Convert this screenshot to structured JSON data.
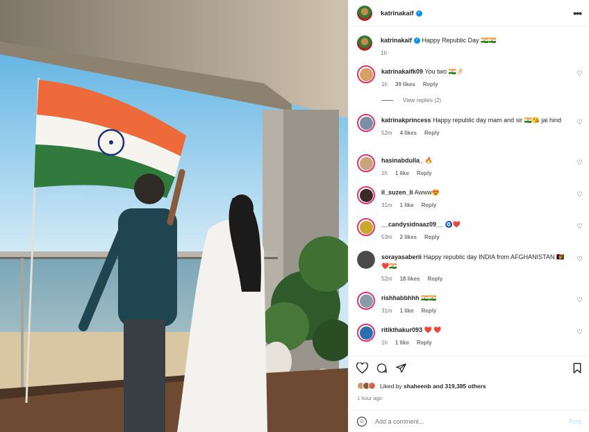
{
  "post": {
    "username": "katrinakaif",
    "verified_glyph": "✓",
    "more_glyph": "•••",
    "caption_text": "Happy Republic Day 🇮🇳🇮🇳",
    "caption_time": "1h",
    "liked_by_prefix": "Liked by ",
    "liked_by_user": "shaheenb",
    "liked_by_suffix": " and 319,385 others",
    "time_ago": "1 hour ago",
    "view_replies": "View replies (2)"
  },
  "comments": [
    {
      "user": "katrinakaifk09",
      "text": "You two 🇮🇳🤌🏻",
      "time": "1h",
      "likes": "39 likes",
      "reply": "Reply",
      "avatar_color": "#d9a066"
    },
    {
      "user": "katrinakprincess",
      "text": "Happy republic day mam and sir 🇮🇳😘 jai hind",
      "time": "52m",
      "likes": "4 likes",
      "reply": "Reply",
      "avatar_color": "#7a8fa6"
    },
    {
      "user": "hasinabdulla_",
      "text": "🔥",
      "time": "1h",
      "likes": "1 like",
      "reply": "Reply",
      "avatar_color": "#c9a37a"
    },
    {
      "user": "il_suzen_li",
      "text": "Awww😍",
      "time": "31m",
      "likes": "1 like",
      "reply": "Reply",
      "avatar_color": "#3b2a25"
    },
    {
      "user": "__candysidnaaz09__",
      "text": "🧿❤️",
      "time": "53m",
      "likes": "2 likes",
      "reply": "Reply",
      "avatar_color": "#c9a82c"
    },
    {
      "user": "sorayasaberii",
      "text": "Happy republic day INDIA from AFGHANISTAN 🇦🇫❤️🇮🇳",
      "time": "52m",
      "likes": "18 likes",
      "reply": "Reply",
      "avatar_color": "#4a4a4a"
    },
    {
      "user": "rishhabbhhh",
      "text": "🇮🇳🇮🇳",
      "time": "31m",
      "likes": "1 like",
      "reply": "Reply",
      "avatar_color": "#8a9aa8"
    },
    {
      "user": "ritikthakur093",
      "text": "❤️ ❤️",
      "time": "1h",
      "likes": "1 like",
      "reply": "Reply",
      "avatar_color": "#2a6fb0"
    }
  ],
  "input": {
    "placeholder": "Add a comment...",
    "post_label": "Post",
    "emoji_glyph": "☺"
  },
  "icons": {
    "heart": "♡",
    "comment": "◯",
    "share": "➢",
    "bookmark": "▯"
  },
  "colors": {
    "verified": "#0095f6",
    "ring": "#e1306c",
    "post_disabled": "#b2dffc"
  }
}
